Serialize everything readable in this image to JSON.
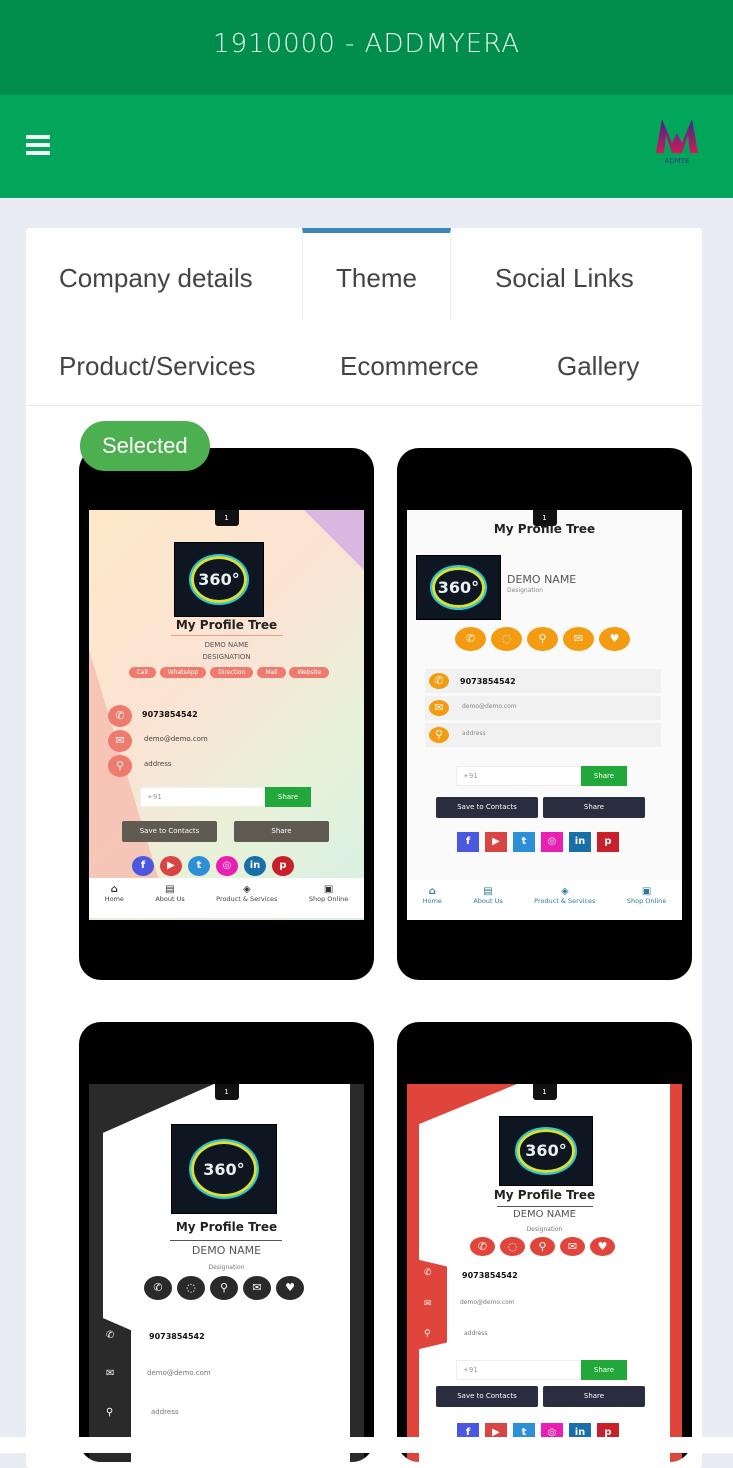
{
  "status_bar": {
    "title": "1910000 - ADDMYERA"
  },
  "app_bar": {
    "menu_icon": "hamburger-icon",
    "logo_icon": "addmyera-logo"
  },
  "tabs": [
    {
      "label": "Company details",
      "active": false
    },
    {
      "label": "Theme",
      "active": true
    },
    {
      "label": "Social Links",
      "active": false
    },
    {
      "label": "Product/Services",
      "active": false
    },
    {
      "label": "Ecommerce",
      "active": false
    },
    {
      "label": "Gallery",
      "active": false
    }
  ],
  "selected_badge": "Selected",
  "card": {
    "title": "My Profile Tree",
    "name": "DEMO NAME",
    "designation": "Designation",
    "designation_upper": "DESIGNATION",
    "phone": "9073854542",
    "email": "demo@demo.com",
    "address": "address",
    "input_placeholder": "+91",
    "whatsapp_share": "Share",
    "save_contacts": "Save to Contacts",
    "share": "Share",
    "notch_label": "1",
    "pill_buttons": [
      "Call",
      "WhatsApp",
      "Direction",
      "Mail",
      "Website"
    ],
    "logo_text": "360°",
    "social": [
      "f",
      "▶",
      "t",
      "◎",
      "in",
      "p"
    ],
    "nav": [
      {
        "icon": "⌂",
        "label": "Home"
      },
      {
        "icon": "▤",
        "label": "About Us"
      },
      {
        "icon": "◈",
        "label": "Product & Services"
      },
      {
        "icon": "▣",
        "label": "Shop Online"
      }
    ]
  },
  "colors": {
    "brand_dark": "#018e4c",
    "brand": "#02a65b",
    "active_tab": "#3f86b8",
    "selected": "#4caf50",
    "orange": "#f39c12",
    "salmon": "#ee7b6e",
    "red": "#e0453b",
    "dark": "#2b2a2a",
    "navy": "#2a2c3f"
  }
}
